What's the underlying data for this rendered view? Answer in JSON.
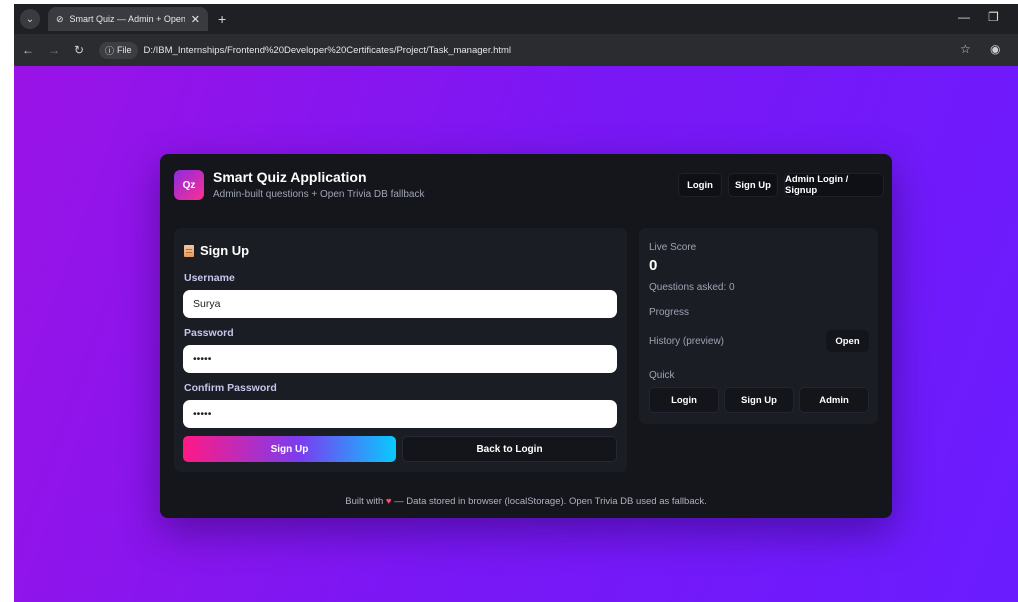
{
  "browser": {
    "tab_title": "Smart Quiz — Admin + OpenTr",
    "tab_close": "✕",
    "new_tab": "+",
    "file_chip": "File",
    "url": "D:/IBM_Internships/Frontend%20Developer%20Certificates/Project/Task_manager.html"
  },
  "header": {
    "logo_text": "Qz",
    "title": "Smart Quiz Application",
    "subtitle": "Admin-built questions + Open Trivia DB fallback",
    "login_label": "Login",
    "signup_label": "Sign Up",
    "admin_label": "Admin Login / Signup"
  },
  "signup_form": {
    "title": "Sign Up",
    "username_label": "Username",
    "username_value": "Surya",
    "password_label": "Password",
    "password_value": "•••••",
    "confirm_label": "Confirm Password",
    "confirm_value": "•••••",
    "submit_label": "Sign Up",
    "back_label": "Back to Login"
  },
  "sidebar": {
    "score_label": "Live Score",
    "score_value": "0",
    "questions_asked": "Questions asked: 0",
    "progress_label": "Progress",
    "history_label": "History (preview)",
    "open_label": "Open",
    "quick_label": "Quick",
    "quick_login": "Login",
    "quick_signup": "Sign Up",
    "quick_admin": "Admin"
  },
  "footer": {
    "prefix": "Built with",
    "heart": "♥",
    "suffix": "— Data stored in browser (localStorage). Open Trivia DB used as fallback."
  },
  "colors": {
    "bg_gradient_start": "#9a13e6",
    "bg_gradient_end": "#6a1cff",
    "card_bg": "#15161c",
    "panel_bg": "#1b1d25",
    "accent_pink": "#ff1985",
    "accent_cyan": "#09c9ff"
  }
}
